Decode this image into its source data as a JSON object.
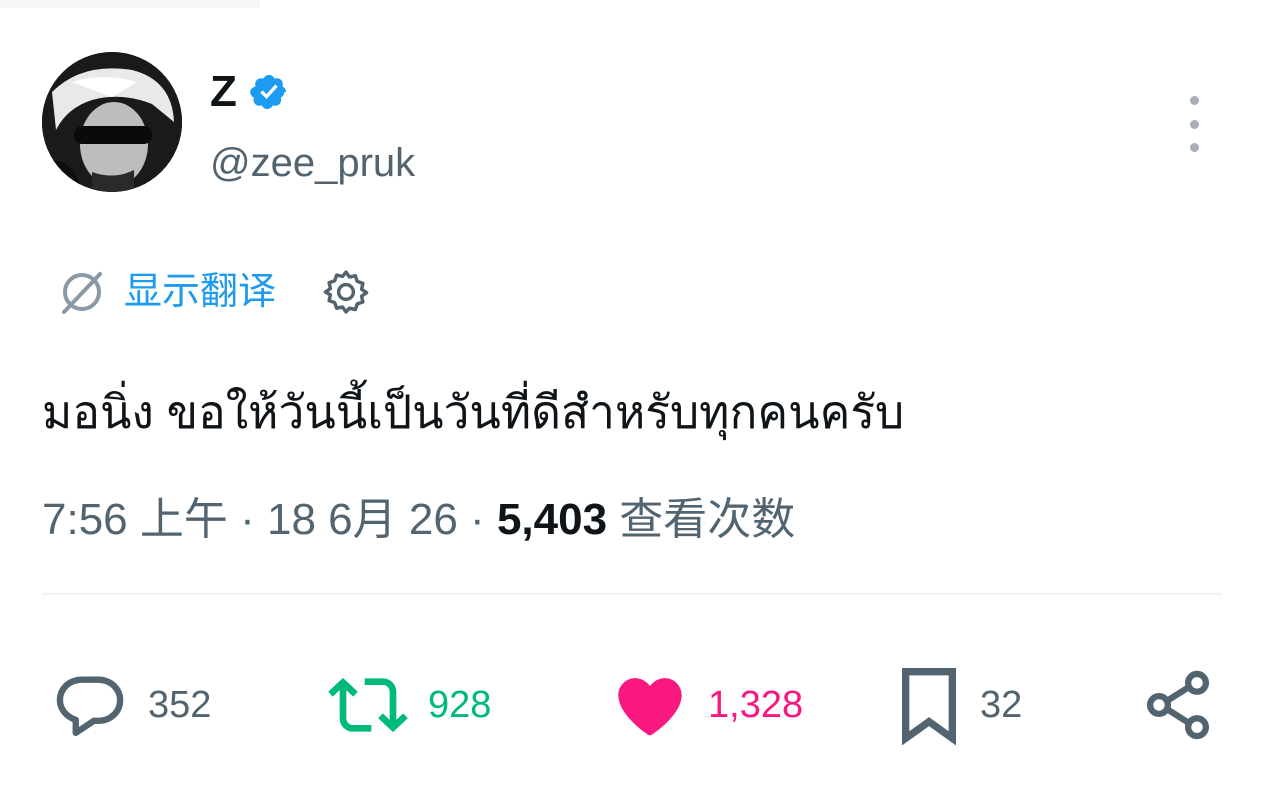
{
  "author": {
    "display_name": "Z",
    "handle": "@zee_pruk",
    "verified": true,
    "verified_color": "#1d9bf0"
  },
  "translate": {
    "label": "显示翻译"
  },
  "tweet": {
    "text": "มอนิ่ง ขอให้วันนี้เป็นวันที่ดีสำหรับทุกคนครับ"
  },
  "meta": {
    "time": "7:56 上午",
    "date": "18 6月 26",
    "views_count": "5,403",
    "views_label": "查看次数",
    "separator": "·"
  },
  "actions": {
    "reply_count": "352",
    "repost_count": "928",
    "like_count": "1,328",
    "bookmark_count": "32"
  },
  "colors": {
    "accent": "#1d9bf0",
    "repost": "#00ba7c",
    "like": "#f91880",
    "secondary_text": "#536471"
  },
  "icons": [
    "verified-badge-icon",
    "more-options-icon",
    "translate-icon",
    "settings-gear-icon",
    "reply-icon",
    "repost-icon",
    "like-heart-icon",
    "bookmark-icon",
    "share-icon"
  ]
}
